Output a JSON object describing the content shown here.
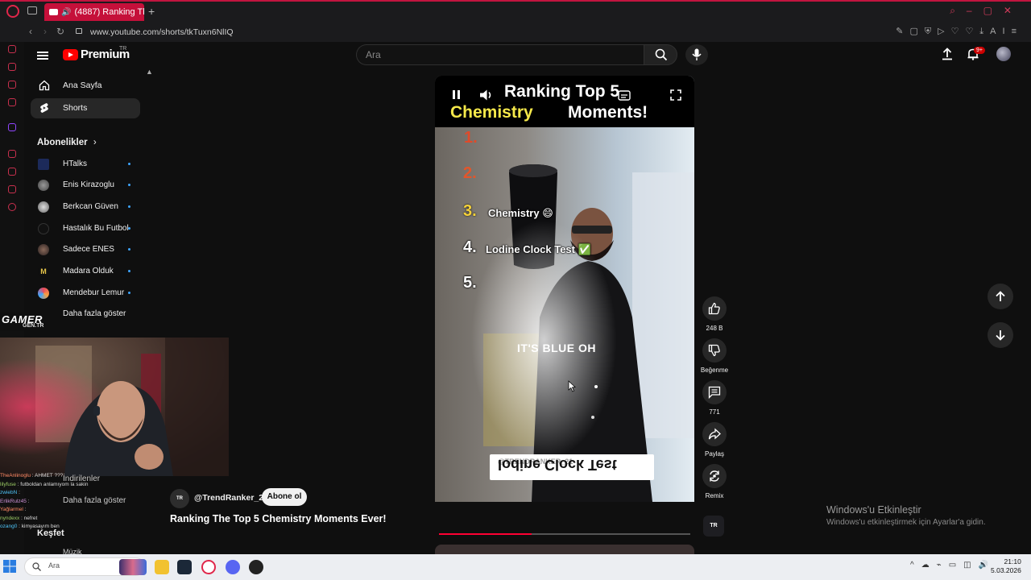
{
  "browser": {
    "tab_title": "(4887) Ranking The To",
    "url": "www.youtube.com/shorts/tkTuxn6NlIQ",
    "ai_label": "AI"
  },
  "header": {
    "brand": "Premium",
    "brand_region": "TR",
    "search_placeholder": "Ara",
    "notification_count": "9+"
  },
  "sidebar": {
    "items": [
      {
        "label": "Ana Sayfa"
      },
      {
        "label": "Shorts"
      }
    ],
    "subscriptions_title": "Abonelikler",
    "subscriptions": [
      {
        "name": "HTalks"
      },
      {
        "name": "Enis Kirazoglu"
      },
      {
        "name": "Berkcan Güven"
      },
      {
        "name": "Hastalık Bu Futbol"
      },
      {
        "name": "Sadece ENES"
      },
      {
        "name": "Madara Olduk"
      },
      {
        "name": "Mendebur Lemur"
      }
    ],
    "show_more": "Daha fazla göster",
    "hidden_section": "İndirilenler",
    "show_more_2": "Daha fazla göster",
    "explore": "Keşfet",
    "music": "Müzik"
  },
  "overlay": {
    "brand": "GAMER",
    "brand_sub": "GEN.TR",
    "chat": [
      {
        "user": "TheAnlinoglu",
        "msg": "AHMET ???"
      },
      {
        "user": "lilyfuse",
        "msg": "futboldan anlamıyom la sakin"
      },
      {
        "user": "zwiebN",
        "msg": ""
      },
      {
        "user": "ErlikRulz45",
        "msg": ""
      },
      {
        "user": "Yağlarmel",
        "msg": ""
      },
      {
        "user": "nyndexx",
        "msg": "nefret"
      },
      {
        "user": "ozang0",
        "msg": "kimyasayım ben"
      }
    ]
  },
  "short": {
    "overlay_title_1": "Ranking Top 5",
    "overlay_title_2a": "Chemistry",
    "overlay_title_2b": "Moments!",
    "ranks": [
      {
        "n": "1.",
        "label": ""
      },
      {
        "n": "2.",
        "label": ""
      },
      {
        "n": "3.",
        "label": "Chemistry 😄"
      },
      {
        "n": "4.",
        "label": "Lodine Clock Test ✅"
      },
      {
        "n": "5.",
        "label": ""
      }
    ],
    "caption_mid": "IT'S BLUE OH",
    "caption_bottom": "Iodine Clock Test",
    "watermark": "@TRENDRANKER_21",
    "channel": "@TrendRanker_21",
    "channel_avatar_text": "TR",
    "subscribe": "Abone ol",
    "title": "Ranking The Top 5 Chemistry Moments Ever!",
    "progress": 0.37
  },
  "actions": {
    "likes": "248 B",
    "dislike": "Beğenme",
    "comments": "771",
    "share": "Paylaş",
    "remix": "Remix"
  },
  "windows": {
    "activate_title": "Windows'u Etkinleştir",
    "activate_sub": "Windows'u etkinleştirmek için Ayarlar'a gidin.",
    "search_placeholder": "Ara",
    "time": "21:10",
    "date": "5.03.2026"
  }
}
